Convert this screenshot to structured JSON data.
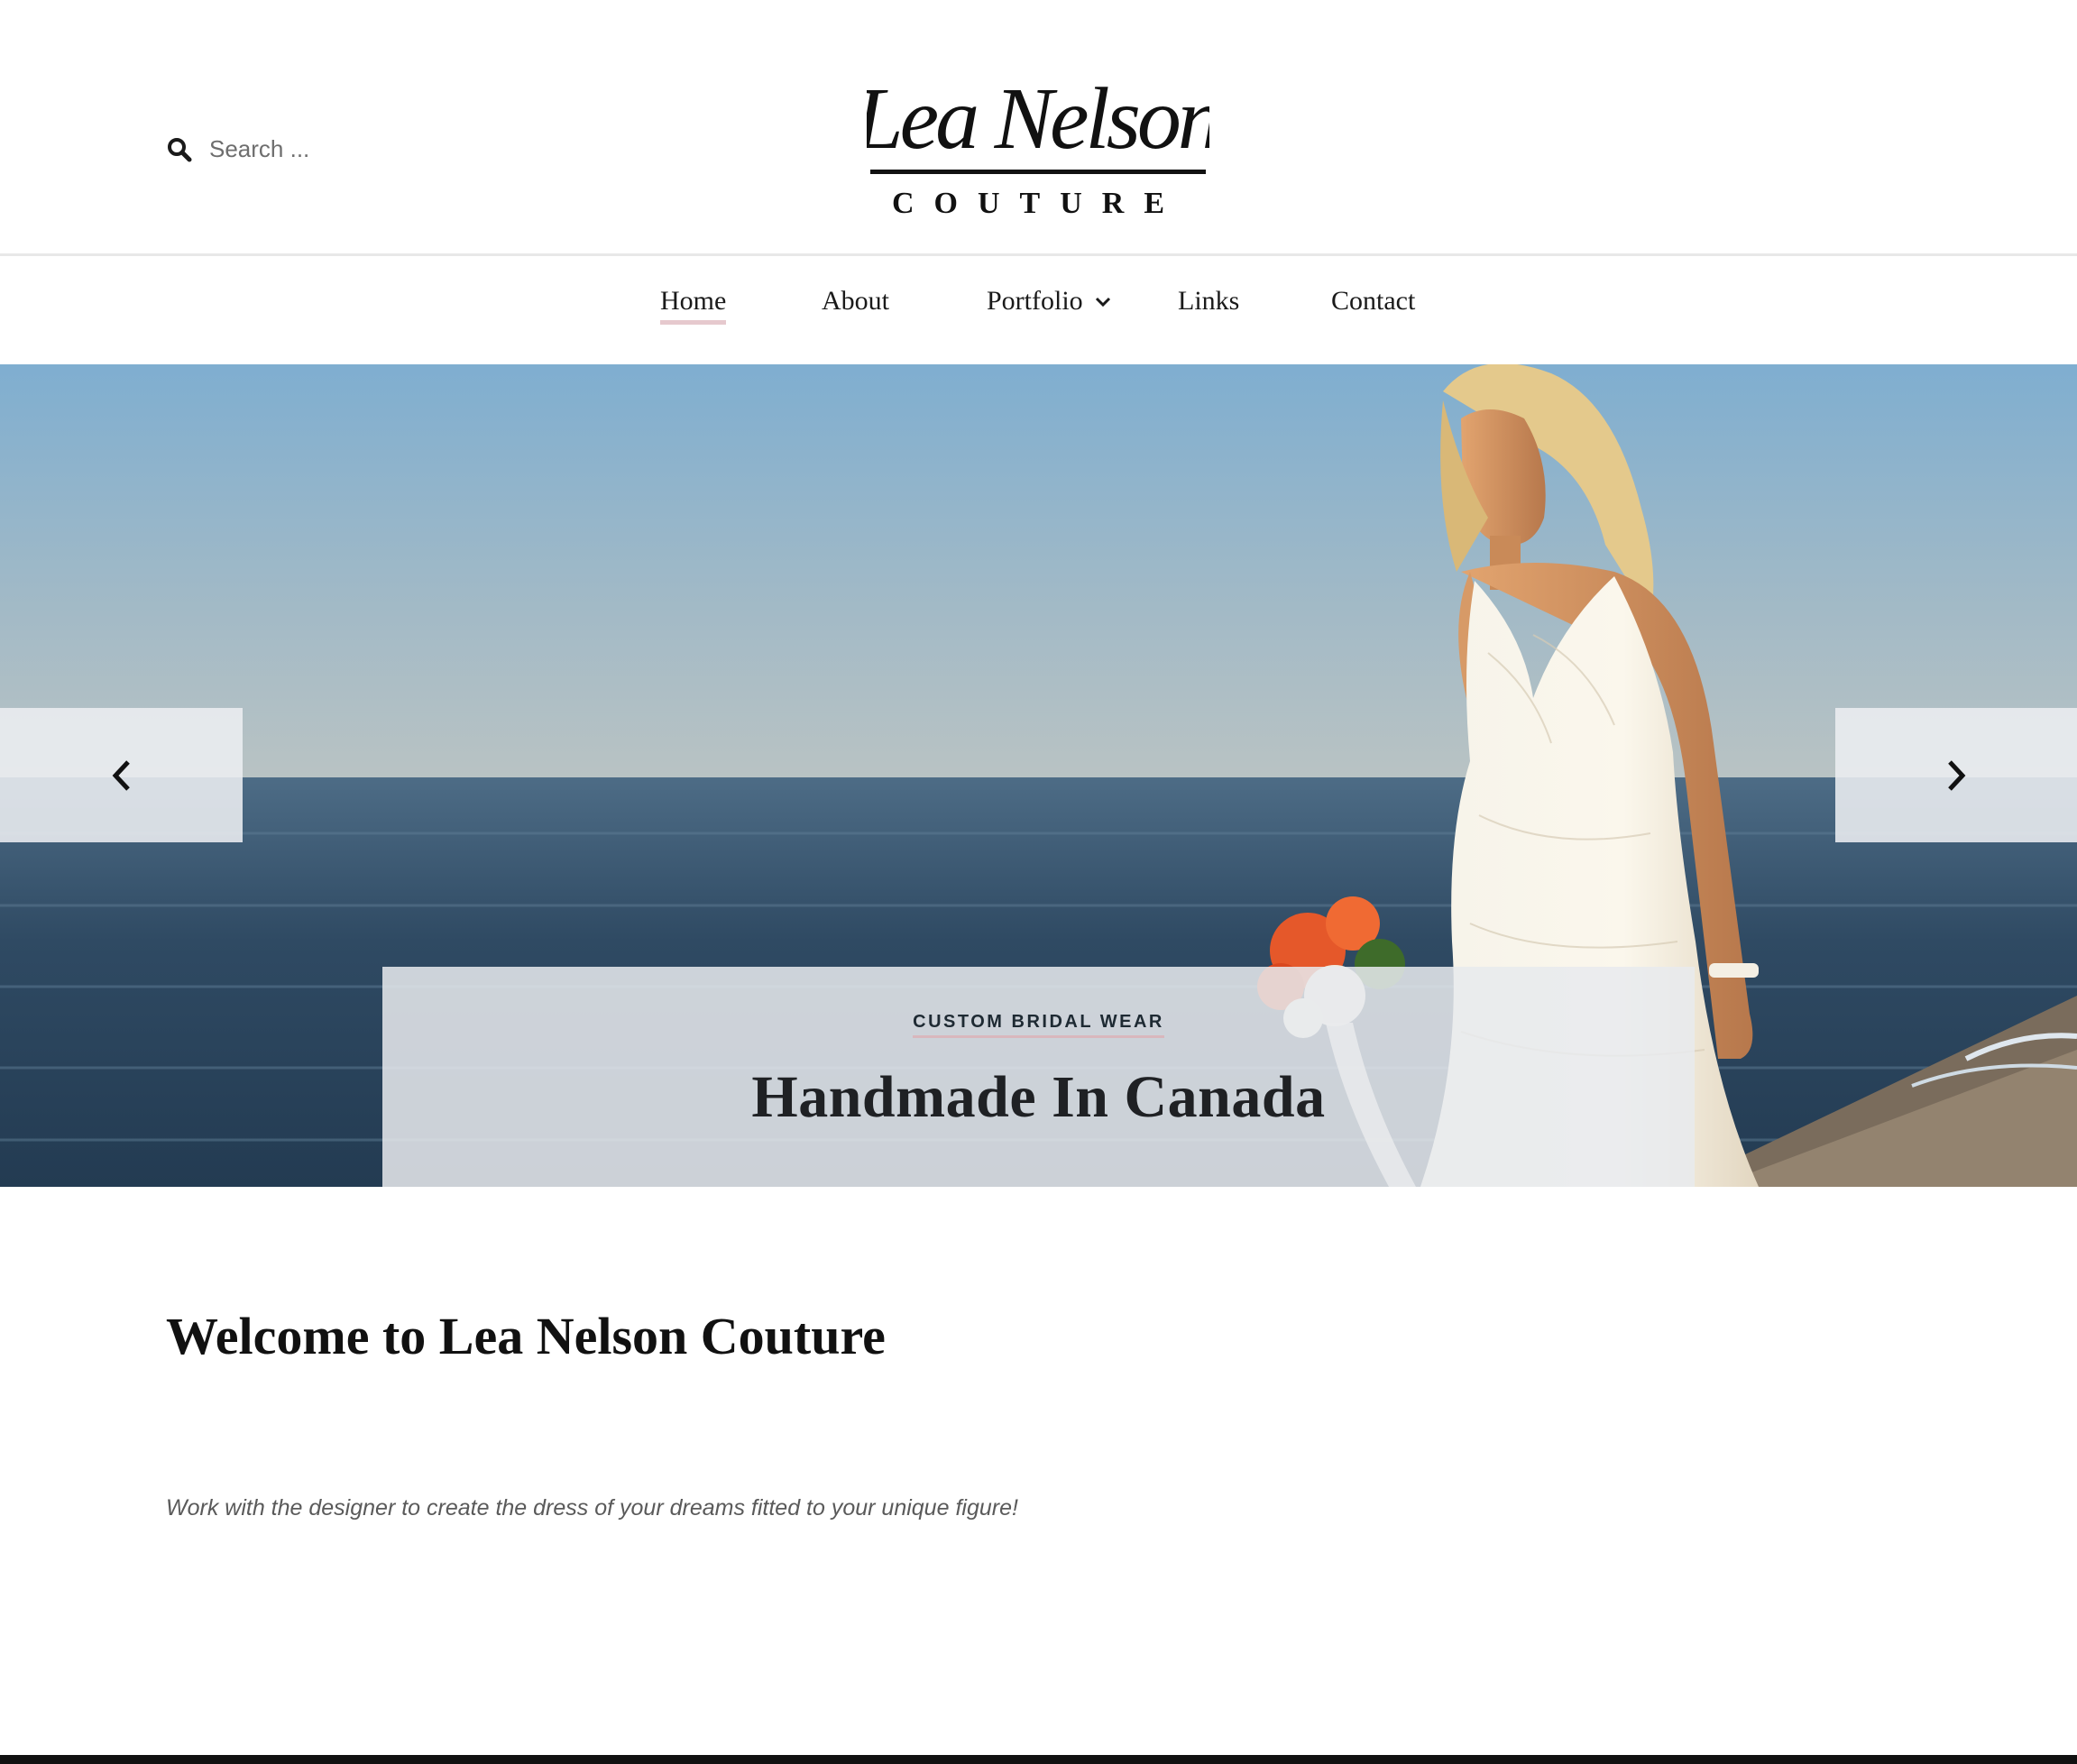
{
  "search": {
    "placeholder": "Search ..."
  },
  "logo": {
    "name": "Lea Nelson",
    "tagline": "COUTURE"
  },
  "nav": {
    "items": [
      {
        "label": "Home",
        "active": true
      },
      {
        "label": "About"
      },
      {
        "label": "Portfolio",
        "has_submenu": true
      },
      {
        "label": "Links"
      },
      {
        "label": "Contact"
      }
    ]
  },
  "hero": {
    "kicker": "CUSTOM BRIDAL WEAR",
    "title": "Handmade In Canada",
    "prev_icon": "chevron-left-icon",
    "next_icon": "chevron-right-icon"
  },
  "content": {
    "heading": "Welcome to Lea Nelson Couture",
    "tagline": "Work with the designer to create the dress of your dreams fitted to your unique figure!"
  },
  "colors": {
    "accent": "#e6c9ce",
    "text": "#1a1a1a",
    "footer": "#111111"
  }
}
